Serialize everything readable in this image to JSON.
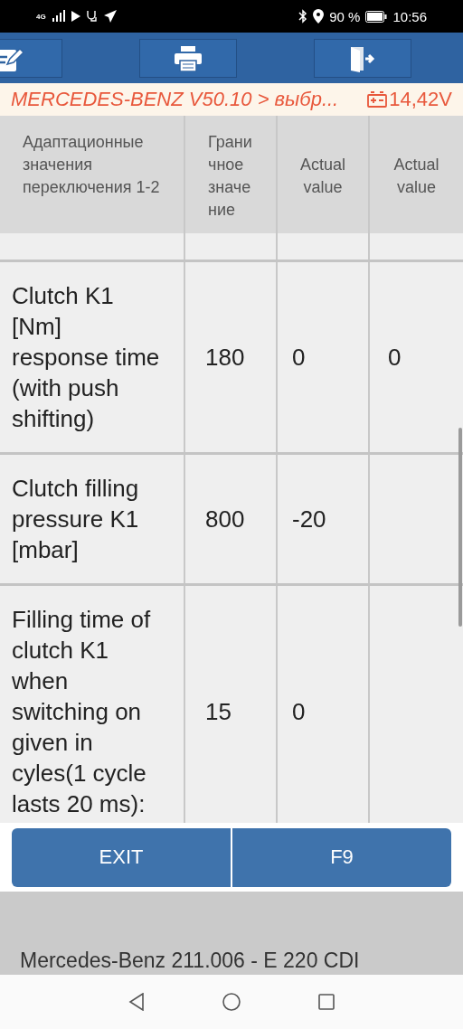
{
  "status_bar": {
    "network": "4G",
    "battery": "90 %",
    "time": "10:56"
  },
  "title_bar": {
    "path": "MERCEDES-BENZ V50.10 > выбр...",
    "voltage": "14,42V"
  },
  "table": {
    "columns": [
      "Адаптационные значения переключения 1-2",
      "Грани чное значе ние",
      "Actual value",
      "Actual value"
    ],
    "rows": [
      {
        "cells": [
          "",
          "",
          "",
          ""
        ],
        "kind": "partial"
      },
      {
        "cells": [
          "Clutch K1 [Nm] response time (with push shifting)",
          "180",
          "0",
          "0"
        ],
        "kind": "full"
      },
      {
        "cells": [
          "Clutch filling pressure K1 [mbar]",
          "800",
          "-20",
          ""
        ],
        "kind": "full"
      },
      {
        "cells": [
          "Filling time of clutch K1 when switching on given in cyles(1 cycle lasts 20 ms):",
          "15",
          "0",
          ""
        ],
        "kind": "cut"
      }
    ]
  },
  "buttons": [
    "EXIT",
    "F9"
  ],
  "footer": "Mercedes-Benz 211.006 - E 220 CDI"
}
